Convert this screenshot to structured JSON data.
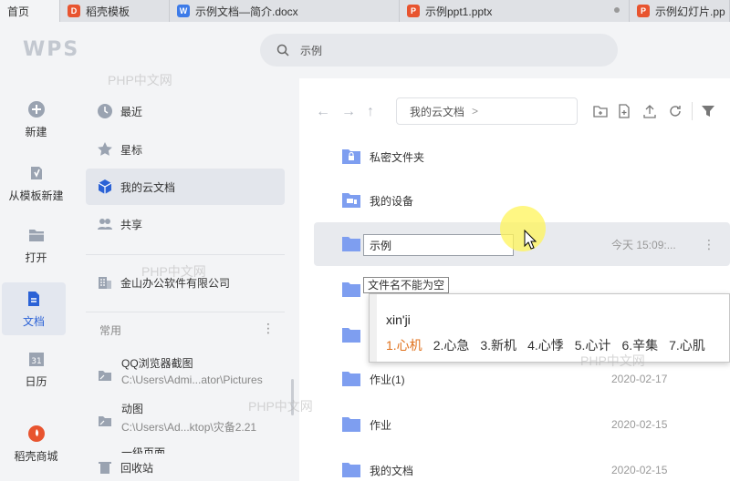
{
  "tabs": [
    {
      "label": "首页",
      "active": true
    },
    {
      "label": "稻壳模板",
      "icon": "docer-icon",
      "icon_color": "#e8542f"
    },
    {
      "label": "示例文档—简介.docx",
      "icon": "word-icon",
      "icon_color": "#3d7be8"
    },
    {
      "label": "示例ppt1.pptx",
      "icon": "ppt-icon",
      "icon_color": "#e8542f"
    },
    {
      "label": "示例幻灯片.pp",
      "icon": "ppt-icon",
      "icon_color": "#e8542f"
    }
  ],
  "header": {
    "logo": "WPS",
    "search_value": "示例"
  },
  "rail": [
    {
      "label": "新建",
      "icon": "plus-circle-icon"
    },
    {
      "label": "从模板新建",
      "icon": "template-icon"
    },
    {
      "label": "打开",
      "icon": "folder-open-icon"
    },
    {
      "label": "文档",
      "icon": "document-icon",
      "active": true
    },
    {
      "label": "日历",
      "icon": "calendar-icon"
    },
    {
      "label": "稻壳商城",
      "icon": "docer-store-icon"
    }
  ],
  "nav": {
    "items": [
      {
        "label": "最近",
        "icon": "clock-icon"
      },
      {
        "label": "星标",
        "icon": "star-icon"
      },
      {
        "label": "我的云文档",
        "icon": "cloud-cube-icon",
        "active": true
      },
      {
        "label": "共享",
        "icon": "share-users-icon"
      }
    ],
    "company": "金山办公软件有限公司",
    "section_title": "常用",
    "recent": [
      {
        "name": "QQ浏览器截图",
        "path": "C:\\Users\\Admi...ator\\Pictures"
      },
      {
        "name": "动图",
        "path": "C:\\Users\\Ad...ktop\\灾备2.21"
      },
      {
        "name": "一级页面",
        "path": ""
      }
    ],
    "recycle": "回收站"
  },
  "toolbar": {
    "breadcrumb": "我的云文档",
    "breadcrumb_chevron": ">"
  },
  "files": [
    {
      "name": "私密文件夹",
      "date": "",
      "icon": "locked-folder-icon"
    },
    {
      "name": "我的设备",
      "date": "",
      "icon": "device-folder-icon"
    },
    {
      "name": "",
      "date": "今天 15:09:...",
      "icon": "folder-icon",
      "selected": true
    },
    {
      "name": "",
      "date": "",
      "icon": "folder-icon"
    },
    {
      "name": "",
      "date": "",
      "icon": "folder-icon"
    },
    {
      "name": "作业(1)",
      "date": "2020-02-17",
      "icon": "folder-icon"
    },
    {
      "name": "作业",
      "date": "2020-02-15",
      "icon": "folder-icon"
    },
    {
      "name": "我的文档",
      "date": "2020-02-15",
      "icon": "folder-icon"
    }
  ],
  "rename": {
    "value": "示例",
    "error": "文件名不能为空"
  },
  "ime": {
    "composition": "xin'ji",
    "candidates": [
      "1.心机",
      "2.心急",
      "3.新机",
      "4.心悸",
      "5.心计",
      "6.辛集",
      "7.心肌"
    ]
  },
  "watermark": "PHP中文网",
  "colors": {
    "accent": "#2b62d6",
    "folder": "#7e9ef0",
    "highlight": "#fff45a",
    "ime_first": "#e0711c"
  }
}
